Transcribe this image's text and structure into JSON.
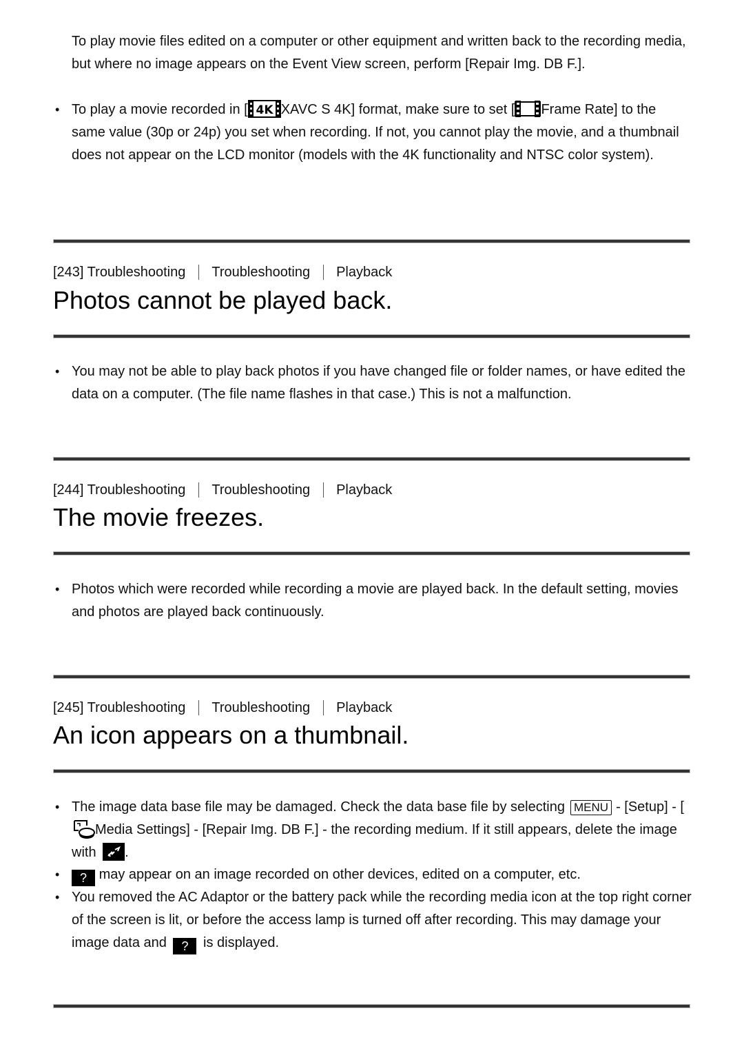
{
  "intro": {
    "para1": "To play movie files edited on a computer or other equipment and written back to the recording media, but where no image appears on the Event View screen, perform [Repair Img. DB F.].",
    "bullet1_a": "To play a movie recorded in [",
    "bullet1_icon1": "4k-film-icon",
    "bullet1_b": "XAVC S 4K] format, make sure to set [",
    "bullet1_icon2": "film-icon",
    "bullet1_c": "Frame Rate] to the same value (30p or 24p) you set when recording. If not, you cannot play the movie, and a thumbnail does not appear on the LCD monitor (models with the 4K functionality and NTSC color system)."
  },
  "sections": [
    {
      "breadcrumb": [
        "[243] Troubleshooting",
        "Troubleshooting",
        "Playback"
      ],
      "title": "Photos cannot be played back.",
      "bullets": [
        "You may not be able to play back photos if you have changed file or folder names, or have edited the data on a computer. (The file name flashes in that case.) This is not a malfunction."
      ]
    },
    {
      "breadcrumb": [
        "[244] Troubleshooting",
        "Troubleshooting",
        "Playback"
      ],
      "title": "The movie freezes.",
      "bullets": [
        "Photos which were recorded while recording a movie are played back. In the default setting, movies and photos are played back continuously."
      ]
    },
    {
      "breadcrumb": [
        "[245] Troubleshooting",
        "Troubleshooting",
        "Playback"
      ],
      "title": "An icon appears on a thumbnail.",
      "b1": {
        "a": "The image data base file may be damaged. Check the data base file by selecting",
        "menu": "MENU",
        "b": "- [Setup] - [",
        "c": "Media Settings] - [Repair Img. DB F.] - the recording medium. If it still appears, delete the image with",
        "d": "."
      },
      "b2": {
        "q": "?",
        "a": "may appear on an image recorded on other devices, edited on a computer, etc."
      },
      "b3": {
        "a": "You removed the AC Adaptor or the battery pack while the recording media icon at the top right corner of the screen is lit, or before the access lamp is turned off after recording. This may damage your image data and",
        "q": "?",
        "b": "is displayed."
      }
    }
  ]
}
